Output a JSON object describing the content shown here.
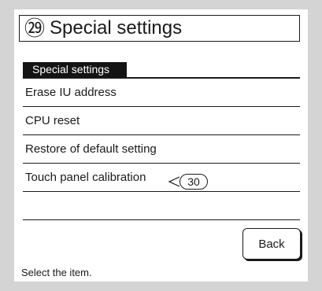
{
  "title": {
    "number": "㉙",
    "text": "Special settings"
  },
  "menu": {
    "header": "Special settings",
    "items": [
      {
        "label": "Erase IU address"
      },
      {
        "label": "CPU reset"
      },
      {
        "label": "Restore of default setting"
      },
      {
        "label": "Touch panel calibration"
      },
      {
        "label": ""
      }
    ]
  },
  "callout": {
    "label": "30"
  },
  "back_button": {
    "label": "Back"
  },
  "status": {
    "text": "Select the item."
  }
}
